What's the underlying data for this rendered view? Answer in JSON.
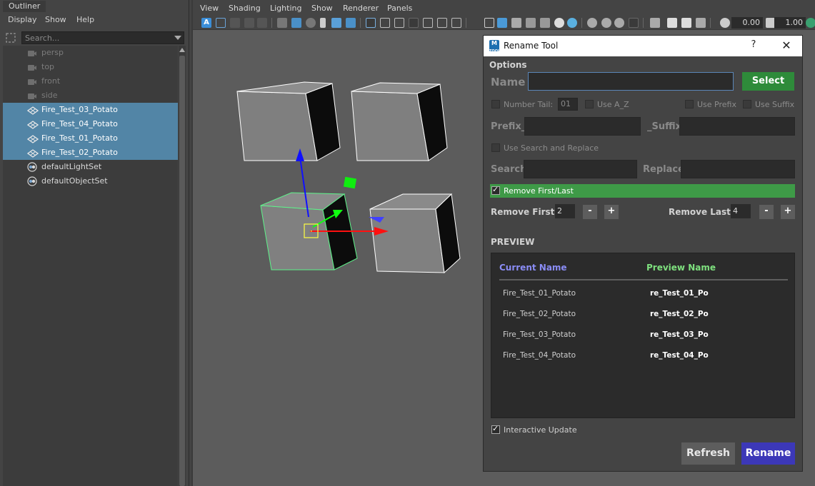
{
  "outliner": {
    "title": "Outliner",
    "menu": [
      "Display",
      "Show",
      "Help"
    ],
    "search_placeholder": "Search...",
    "items": [
      {
        "label": "persp",
        "kind": "camera",
        "selected": false
      },
      {
        "label": "top",
        "kind": "camera",
        "selected": false
      },
      {
        "label": "front",
        "kind": "camera",
        "selected": false
      },
      {
        "label": "side",
        "kind": "camera",
        "selected": false
      },
      {
        "label": "Fire_Test_03_Potato",
        "kind": "mesh",
        "selected": true
      },
      {
        "label": "Fire_Test_04_Potato",
        "kind": "mesh",
        "selected": true
      },
      {
        "label": "Fire_Test_01_Potato",
        "kind": "mesh",
        "selected": true
      },
      {
        "label": "Fire_Test_02_Potato",
        "kind": "mesh",
        "selected": true
      },
      {
        "label": "defaultLightSet",
        "kind": "set",
        "selected": false
      },
      {
        "label": "defaultObjectSet",
        "kind": "set",
        "selected": false
      }
    ]
  },
  "viewport": {
    "menu": [
      "View",
      "Shading",
      "Lighting",
      "Show",
      "Renderer",
      "Panels"
    ],
    "field_exposure": "0.00",
    "field_gamma": "1.00"
  },
  "rename_tool": {
    "title": "Rename Tool",
    "help": "?",
    "close": "✕",
    "options_label": "Options",
    "name_label": "Name",
    "name_value": "",
    "select_label": "Select",
    "number_tail_label": "Number Tail:",
    "number_tail_value": "01",
    "use_az_label": "Use A_Z",
    "use_prefix_label": "Use Prefix",
    "use_suffix_label": "Use Suffix",
    "prefix_label": "Prefix_",
    "suffix_label": "_Suffix",
    "use_search_replace_label": "Use Search and Replace",
    "search_label": "Search",
    "replace_label": "Replace",
    "remove_first_last_label": "Remove First/Last",
    "remove_first_label": "Remove First:",
    "remove_first_value": "2",
    "remove_last_label": "Remove Last:",
    "remove_last_value": "4",
    "minus": "-",
    "plus": "+",
    "preview_label": "PREVIEW",
    "current_name_header": "Current Name",
    "preview_name_header": "Preview Name",
    "rows": [
      {
        "current": "Fire_Test_01_Potato",
        "preview": "re_Test_01_Po"
      },
      {
        "current": "Fire_Test_02_Potato",
        "preview": "re_Test_02_Po"
      },
      {
        "current": "Fire_Test_03_Potato",
        "preview": "re_Test_03_Po"
      },
      {
        "current": "Fire_Test_04_Potato",
        "preview": "re_Test_04_Po"
      }
    ],
    "interactive_update_label": "Interactive Update",
    "refresh_label": "Refresh",
    "rename_label": "Rename"
  },
  "colors": {
    "selection": "#5285a6",
    "select_button": "#2e8b3a",
    "remove_row": "#3e9a47",
    "rename_button": "#3c38b8",
    "current_header": "#8a8cf5",
    "preview_header": "#7ee07e"
  }
}
